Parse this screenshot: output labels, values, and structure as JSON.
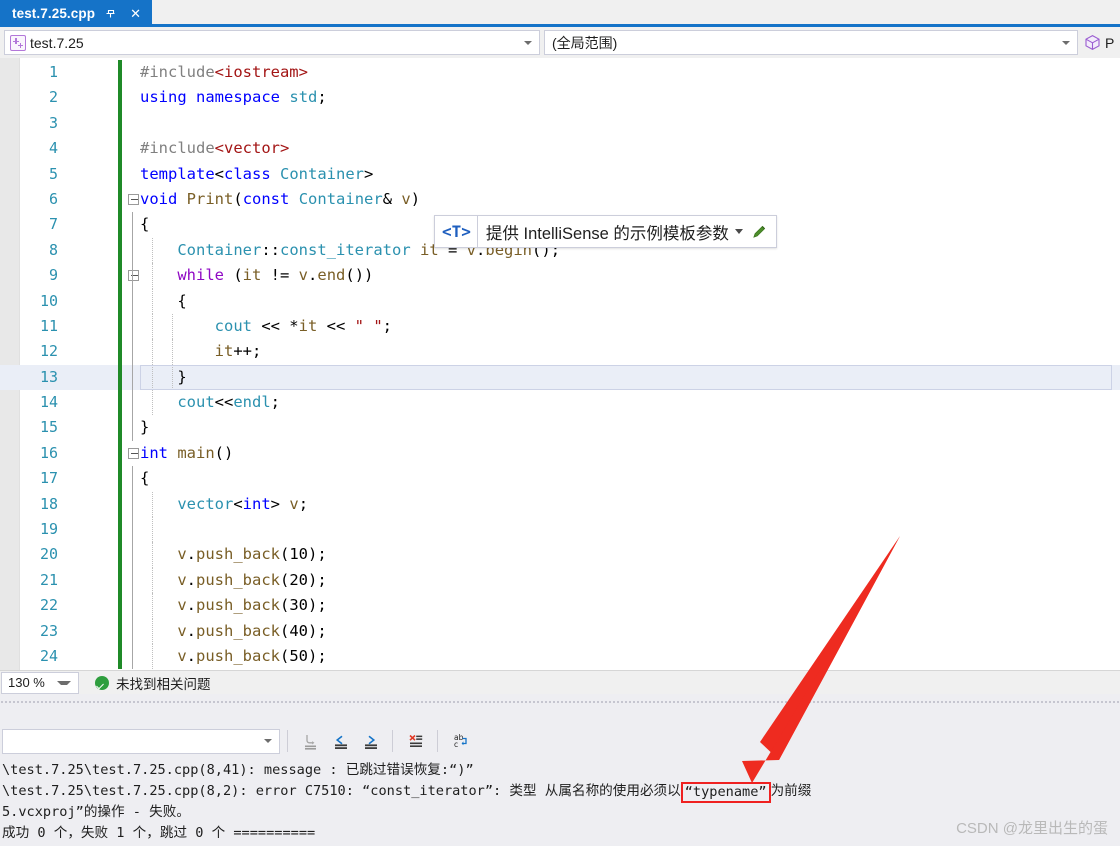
{
  "tab": {
    "title": "test.7.25.cpp",
    "pin_icon": "pin-icon",
    "close_icon": "close-icon"
  },
  "navbar": {
    "scope_left": "test.7.25",
    "scope_right": "(全局范围)",
    "package_label": "P",
    "package_icon": "package-cube-icon"
  },
  "intellisense": {
    "tag": "<T>",
    "text": "提供 IntelliSense 的示例模板参数",
    "caret_icon": "chevron-down-icon",
    "pencil_icon": "pencil-icon"
  },
  "editor": {
    "lines": [
      {
        "n": "1",
        "code": "#include<iostream>"
      },
      {
        "n": "2",
        "code": "using namespace std;"
      },
      {
        "n": "3",
        "code": ""
      },
      {
        "n": "4",
        "code": "#include<vector>"
      },
      {
        "n": "5",
        "code": "template<class Container>"
      },
      {
        "n": "6",
        "code": "void Print(const Container& v)"
      },
      {
        "n": "7",
        "code": "{"
      },
      {
        "n": "8",
        "code": "    Container::const_iterator it = v.begin();"
      },
      {
        "n": "9",
        "code": "    while (it != v.end())"
      },
      {
        "n": "10",
        "code": "    {"
      },
      {
        "n": "11",
        "code": "        cout << *it << \" \";"
      },
      {
        "n": "12",
        "code": "        it++;"
      },
      {
        "n": "13",
        "code": "    }"
      },
      {
        "n": "14",
        "code": "    cout<<endl;"
      },
      {
        "n": "15",
        "code": "}"
      },
      {
        "n": "16",
        "code": "int main()"
      },
      {
        "n": "17",
        "code": "{"
      },
      {
        "n": "18",
        "code": "    vector<int> v;"
      },
      {
        "n": "19",
        "code": ""
      },
      {
        "n": "20",
        "code": "    v.push_back(10);"
      },
      {
        "n": "21",
        "code": "    v.push_back(20);"
      },
      {
        "n": "22",
        "code": "    v.push_back(30);"
      },
      {
        "n": "23",
        "code": "    v.push_back(40);"
      },
      {
        "n": "24",
        "code": "    v.push_back(50);"
      }
    ]
  },
  "editor_status": {
    "zoom": "130 %",
    "problems": "未找到相关问题",
    "ok_icon": "check-circle-icon"
  },
  "output_toolbar": {
    "source_value": "",
    "buttons": [
      {
        "name": "go-to-output-icon",
        "label": ""
      },
      {
        "name": "find-previous-message-icon",
        "label": ""
      },
      {
        "name": "find-next-message-icon",
        "label": ""
      },
      {
        "name": "clear-all-icon",
        "label": ""
      },
      {
        "name": "toggle-word-wrap-icon",
        "label": ""
      }
    ]
  },
  "output": {
    "line1": "\\test.7.25\\test.7.25.cpp(8,41): message : 已跳过错误恢复:“)”",
    "line2_prefix": "\\test.7.25\\test.7.25.cpp(8,2): error C7510: “const_iterator”: 类型 从属名称的使用必须以",
    "line2_highlight": "“typename”",
    "line2_suffix": "为前缀",
    "line3": "5.vcxproj”的操作 - 失败。",
    "line4": "成功 0 个，失败 1 个，跳过 0 个 =========="
  },
  "annotation": {
    "arrow_color": "#ee2b20",
    "highlight_color": "#ef2121"
  },
  "watermark": "CSDN @龙里出生的蛋"
}
